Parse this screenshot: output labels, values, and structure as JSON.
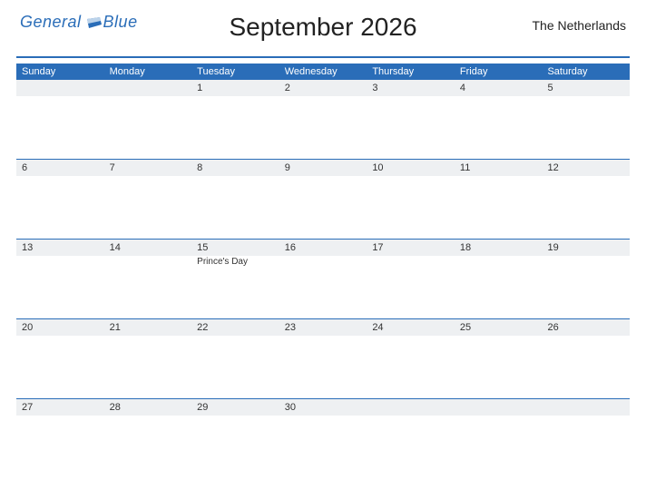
{
  "logo": {
    "part1": "General",
    "part2": "Blue"
  },
  "title": "September 2026",
  "region": "The Netherlands",
  "day_headers": [
    "Sunday",
    "Monday",
    "Tuesday",
    "Wednesday",
    "Thursday",
    "Friday",
    "Saturday"
  ],
  "weeks": [
    {
      "cells": [
        {
          "date": "",
          "holiday": ""
        },
        {
          "date": "",
          "holiday": ""
        },
        {
          "date": "1",
          "holiday": ""
        },
        {
          "date": "2",
          "holiday": ""
        },
        {
          "date": "3",
          "holiday": ""
        },
        {
          "date": "4",
          "holiday": ""
        },
        {
          "date": "5",
          "holiday": ""
        }
      ]
    },
    {
      "cells": [
        {
          "date": "6",
          "holiday": ""
        },
        {
          "date": "7",
          "holiday": ""
        },
        {
          "date": "8",
          "holiday": ""
        },
        {
          "date": "9",
          "holiday": ""
        },
        {
          "date": "10",
          "holiday": ""
        },
        {
          "date": "11",
          "holiday": ""
        },
        {
          "date": "12",
          "holiday": ""
        }
      ]
    },
    {
      "cells": [
        {
          "date": "13",
          "holiday": ""
        },
        {
          "date": "14",
          "holiday": ""
        },
        {
          "date": "15",
          "holiday": "Prince's Day"
        },
        {
          "date": "16",
          "holiday": ""
        },
        {
          "date": "17",
          "holiday": ""
        },
        {
          "date": "18",
          "holiday": ""
        },
        {
          "date": "19",
          "holiday": ""
        }
      ]
    },
    {
      "cells": [
        {
          "date": "20",
          "holiday": ""
        },
        {
          "date": "21",
          "holiday": ""
        },
        {
          "date": "22",
          "holiday": ""
        },
        {
          "date": "23",
          "holiday": ""
        },
        {
          "date": "24",
          "holiday": ""
        },
        {
          "date": "25",
          "holiday": ""
        },
        {
          "date": "26",
          "holiday": ""
        }
      ]
    },
    {
      "cells": [
        {
          "date": "27",
          "holiday": ""
        },
        {
          "date": "28",
          "holiday": ""
        },
        {
          "date": "29",
          "holiday": ""
        },
        {
          "date": "30",
          "holiday": ""
        },
        {
          "date": "",
          "holiday": ""
        },
        {
          "date": "",
          "holiday": ""
        },
        {
          "date": "",
          "holiday": ""
        }
      ]
    }
  ]
}
